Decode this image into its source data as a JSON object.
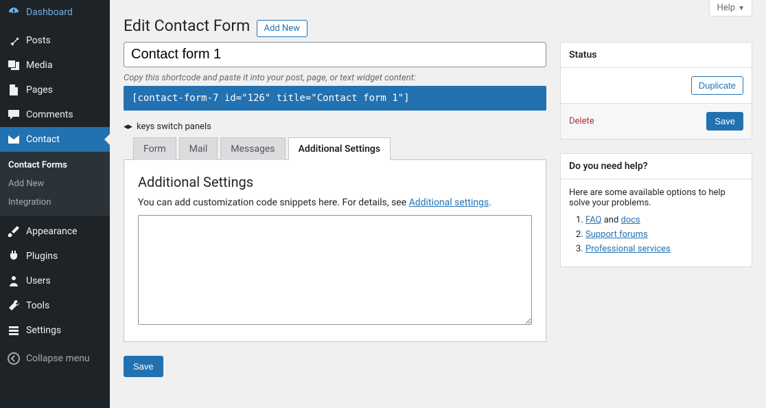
{
  "sidebar": {
    "items": [
      {
        "label": "Dashboard"
      },
      {
        "label": "Posts"
      },
      {
        "label": "Media"
      },
      {
        "label": "Pages"
      },
      {
        "label": "Comments"
      },
      {
        "label": "Contact"
      },
      {
        "label": "Appearance"
      },
      {
        "label": "Plugins"
      },
      {
        "label": "Users"
      },
      {
        "label": "Tools"
      },
      {
        "label": "Settings"
      },
      {
        "label": "Collapse menu"
      }
    ],
    "submenu": [
      {
        "label": "Contact Forms"
      },
      {
        "label": "Add New"
      },
      {
        "label": "Integration"
      }
    ]
  },
  "header": {
    "title": "Edit Contact Form",
    "add_new": "Add New",
    "help": "Help"
  },
  "form": {
    "title_value": "Contact form 1",
    "shortcode_hint": "Copy this shortcode and paste it into your post, page, or text widget content:",
    "shortcode": "[contact-form-7 id=\"126\" title=\"Contact form 1\"]",
    "keys_switch": "keys switch panels",
    "tabs": [
      "Form",
      "Mail",
      "Messages",
      "Additional Settings"
    ],
    "panel": {
      "heading": "Additional Settings",
      "desc_pre": "You can add customization code snippets here. For details, see ",
      "desc_link": "Additional settings",
      "desc_post": "."
    },
    "save": "Save"
  },
  "status": {
    "title": "Status",
    "duplicate": "Duplicate",
    "delete": "Delete",
    "save": "Save"
  },
  "help_box": {
    "title": "Do you need help?",
    "intro": "Here are some available options to help solve your problems.",
    "faq": "FAQ",
    "and": " and ",
    "docs": "docs",
    "support": "Support forums",
    "pro": "Professional services"
  }
}
